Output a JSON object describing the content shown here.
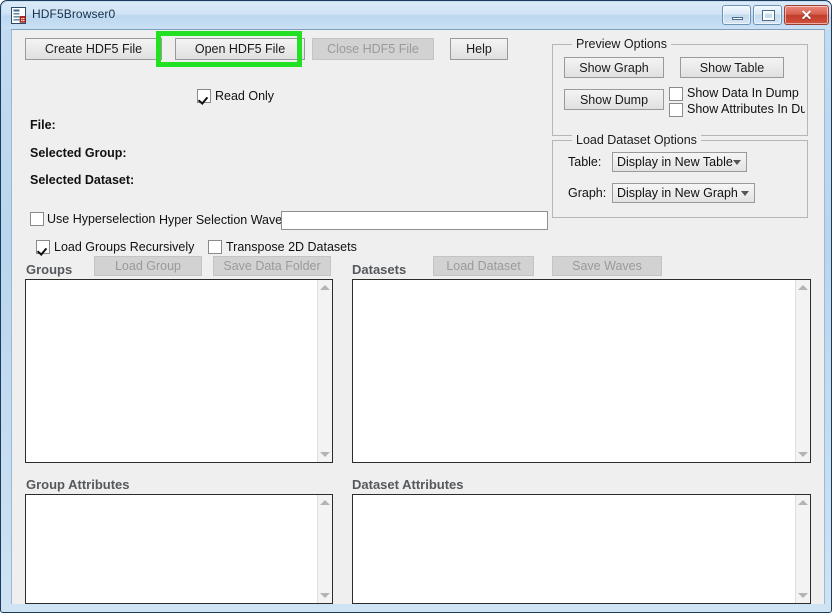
{
  "window": {
    "title": "HDF5Browser0",
    "icon": "hdf5-document-icon",
    "controls": {
      "minimize": "minimize-icon",
      "maximize": "maximize-icon",
      "close_label": "✕"
    },
    "accent_border": "#1b3a5c",
    "titlebar_color": "#cfe2f4",
    "client_bg": "#efefef",
    "annotation_color": "#22e022"
  },
  "toolbar": {
    "create_label": "Create HDF5 File",
    "open_label": "Open HDF5 File",
    "close_label": "Close HDF5 File",
    "help_label": "Help",
    "close_enabled": false,
    "read_only": {
      "label": "Read Only",
      "checked": true
    }
  },
  "info": {
    "file_label": "File:",
    "file_value": "",
    "selected_group_label": "Selected Group:",
    "selected_group_value": "",
    "selected_dataset_label": "Selected Dataset:",
    "selected_dataset_value": ""
  },
  "options": {
    "use_hyperselection": {
      "label": "Use Hyperselection",
      "checked": false
    },
    "hyper_wave_label": "Hyper Selection Wave:",
    "hyper_wave_value": "",
    "hyper_wave_placeholder": "",
    "load_recursively": {
      "label": "Load Groups Recursively",
      "checked": true
    },
    "transpose_2d": {
      "label": "Transpose 2D Datasets",
      "checked": false
    }
  },
  "preview_options": {
    "legend": "Preview Options",
    "show_graph": "Show Graph",
    "show_table": "Show Table",
    "show_dump": "Show Dump",
    "show_data_in_dump": {
      "label": "Show Data In Dump",
      "checked": false
    },
    "show_attributes_in_dump": {
      "label": "Show Attributes In Dump",
      "checked": false
    }
  },
  "load_dataset_options": {
    "legend": "Load Dataset Options",
    "table_label": "Table:",
    "table_value": "Display in New Table",
    "table_options": [
      "Display in New Table"
    ],
    "graph_label": "Graph:",
    "graph_value": "Display in New Graph",
    "graph_options": [
      "Display in New Graph"
    ]
  },
  "panels": {
    "groups": {
      "title": "Groups",
      "load_button": "Load Group",
      "save_button": "Save Data Folder",
      "items": [],
      "buttons_enabled": false
    },
    "datasets": {
      "title": "Datasets",
      "load_button": "Load Dataset",
      "save_button": "Save Waves",
      "items": [],
      "buttons_enabled": false
    },
    "group_attributes": {
      "title": "Group Attributes",
      "items": []
    },
    "dataset_attributes": {
      "title": "Dataset Attributes",
      "items": []
    }
  }
}
